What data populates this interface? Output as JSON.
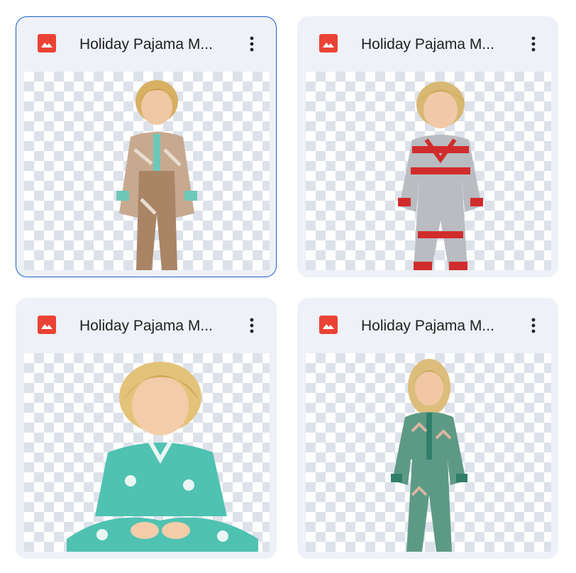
{
  "files": [
    {
      "title": "Holiday Pajama M...",
      "icon": "image-file-icon",
      "pajama_color": "#c9a88e",
      "accent": "#6ec8b8",
      "pattern": "brown-argyle"
    },
    {
      "title": "Holiday Pajama M...",
      "icon": "image-file-icon",
      "pajama_color": "#b9bcc0",
      "accent": "#d12c2c",
      "pattern": "red-fair-isle"
    },
    {
      "title": "Holiday Pajama M...",
      "icon": "image-file-icon",
      "pajama_color": "#4fc2b2",
      "accent": "#e9f6f3",
      "pattern": "teal-satin-polar-bear"
    },
    {
      "title": "Holiday Pajama M...",
      "icon": "image-file-icon",
      "pajama_color": "#5d9a85",
      "accent": "#2f7e6a",
      "pattern": "green-gingerbread"
    }
  ],
  "colors": {
    "file_icon": "#ea4335",
    "selected_border": "#1a5ec9",
    "card_bg": "#eef1f7"
  }
}
